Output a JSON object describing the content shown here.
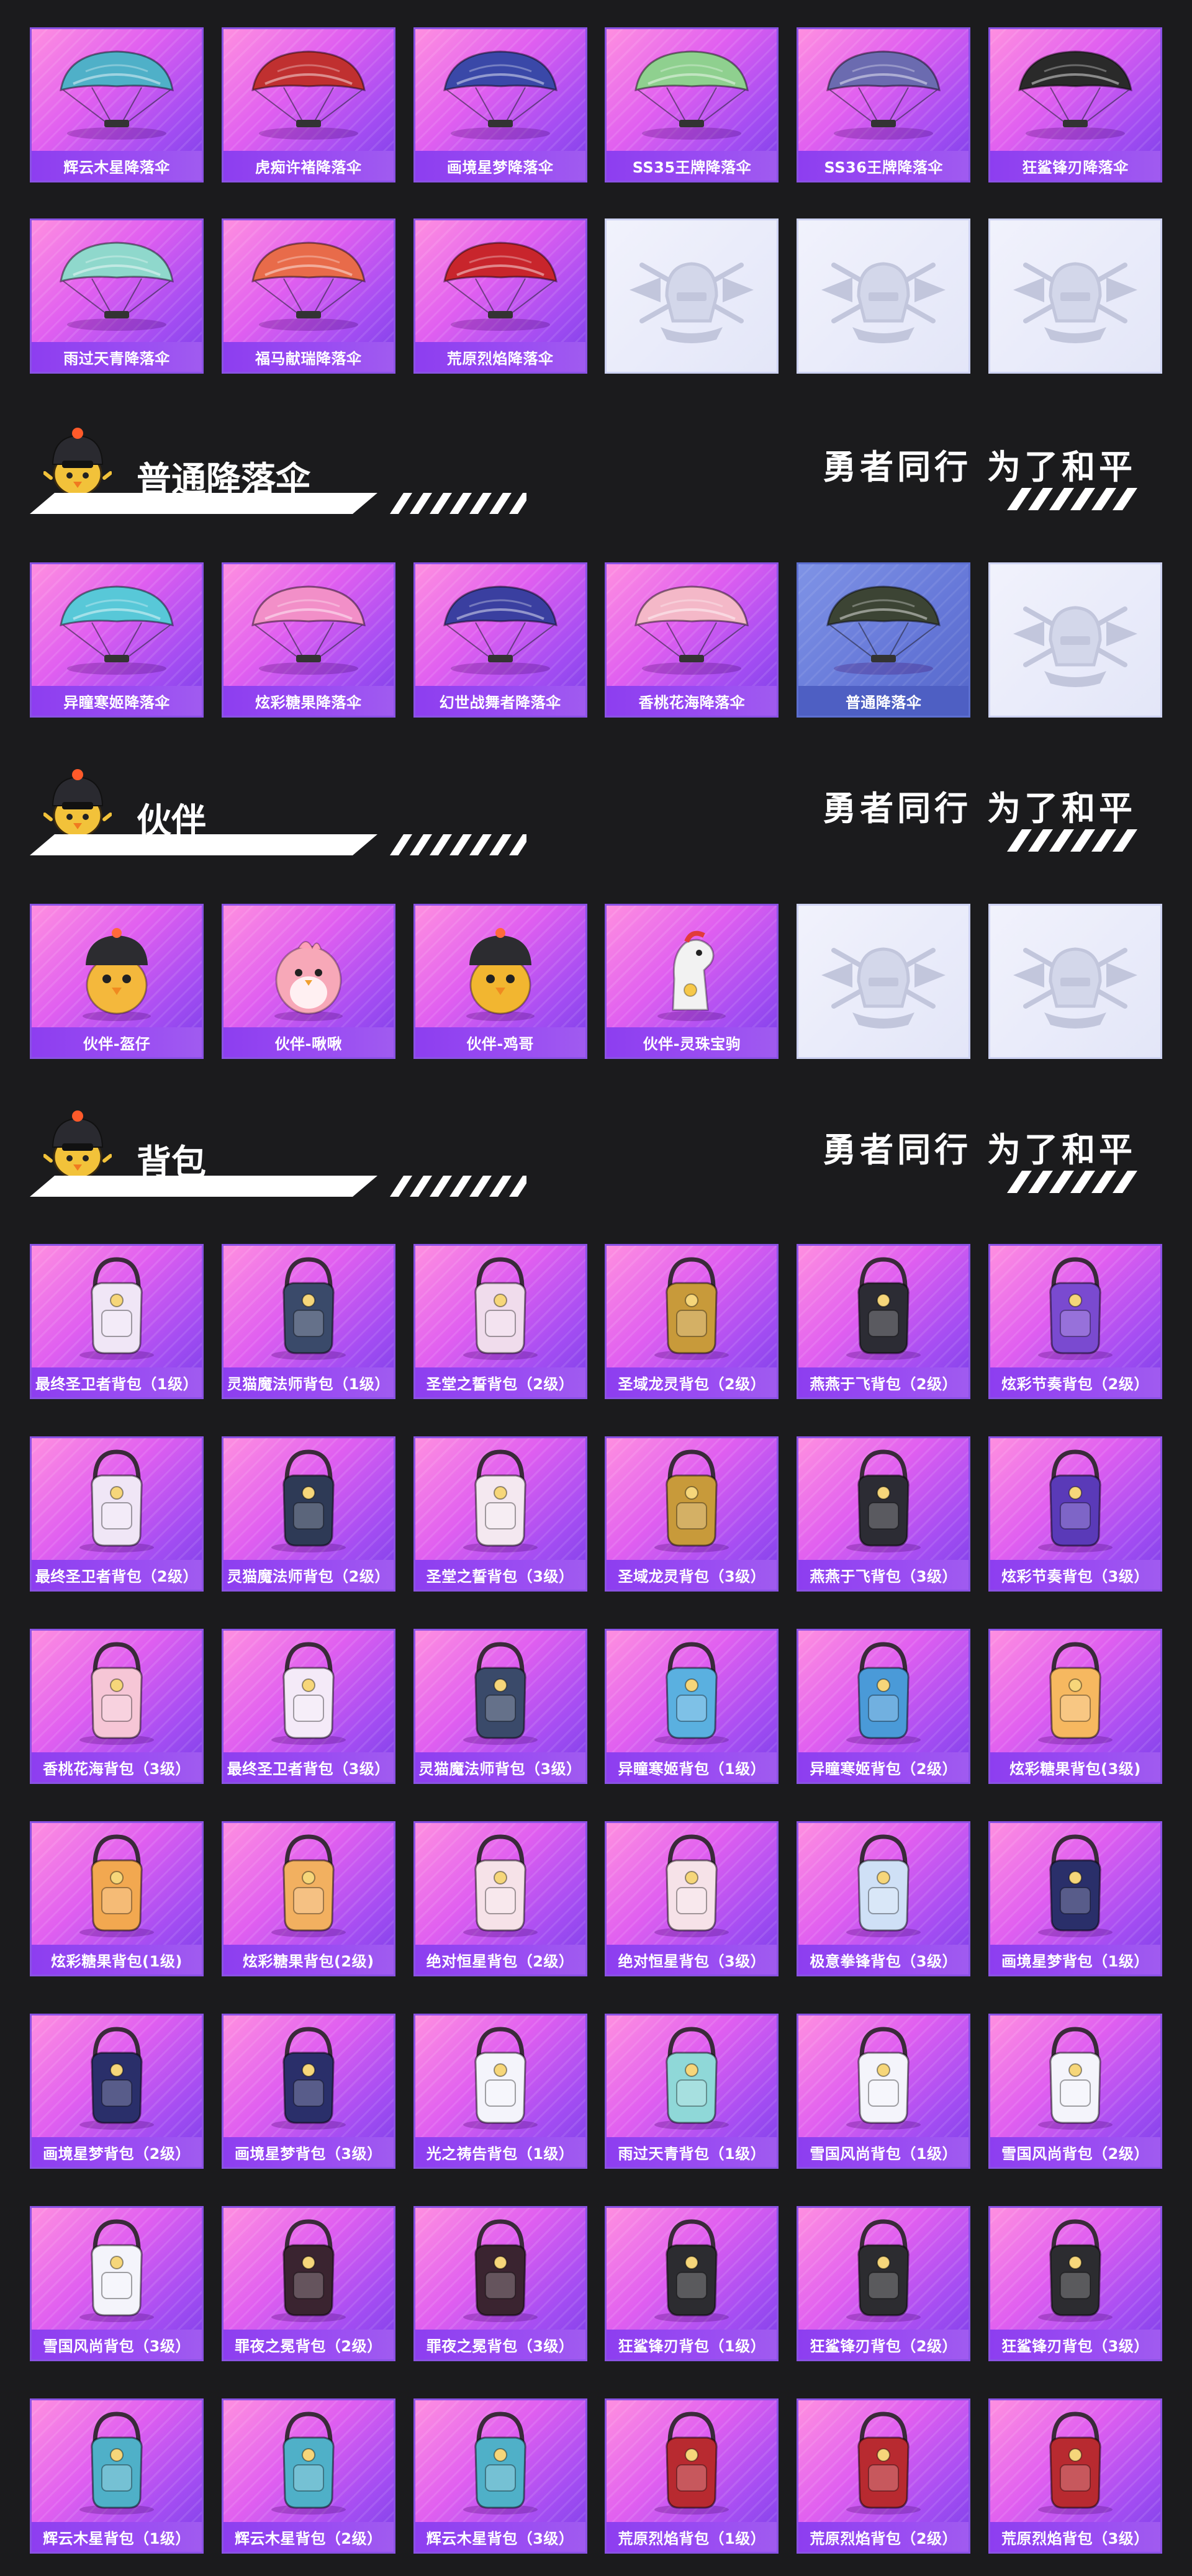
{
  "sections": [
    {
      "title": "",
      "slogan": "",
      "items": [
        {
          "label": "辉云木星降落伞",
          "icon": "parachute-icon",
          "color": "#4fb0c8",
          "type": "normal"
        },
        {
          "label": "虎痴许褚降落伞",
          "icon": "parachute-icon",
          "color": "#c03030",
          "type": "normal"
        },
        {
          "label": "画境星梦降落伞",
          "icon": "parachute-icon",
          "color": "#3a48a8",
          "type": "normal"
        },
        {
          "label": "SS35王牌降落伞",
          "icon": "parachute-icon",
          "color": "#8fd08f",
          "type": "normal"
        },
        {
          "label": "SS36王牌降落伞",
          "icon": "parachute-icon",
          "color": "#6b6bb0",
          "type": "normal"
        },
        {
          "label": "狂鲨锋刃降落伞",
          "icon": "parachute-icon",
          "color": "#2a2a2a",
          "type": "normal"
        },
        {
          "label": "雨过天青降落伞",
          "icon": "parachute-icon",
          "color": "#8fd8cc",
          "type": "normal"
        },
        {
          "label": "福马献瑞降落伞",
          "icon": "parachute-icon",
          "color": "#e86b4a",
          "type": "normal"
        },
        {
          "label": "荒原烈焰降落伞",
          "icon": "parachute-icon",
          "color": "#c8252c",
          "type": "normal"
        },
        {
          "label": "",
          "icon": "pubg-emblem-icon",
          "color": "#c2c6dc",
          "type": "empty"
        },
        {
          "label": "",
          "icon": "pubg-emblem-icon",
          "color": "#c2c6dc",
          "type": "empty"
        },
        {
          "label": "",
          "icon": "pubg-emblem-icon",
          "color": "#c2c6dc",
          "type": "empty"
        }
      ]
    },
    {
      "title": "普通降落伞",
      "slogan": "勇者同行 为了和平",
      "items": [
        {
          "label": "异瞳寒姬降落伞",
          "icon": "parachute-icon",
          "color": "#58c8d8",
          "type": "normal"
        },
        {
          "label": "炫彩糖果降落伞",
          "icon": "parachute-icon",
          "color": "#f28fc8",
          "type": "normal"
        },
        {
          "label": "幻世战舞者降落伞",
          "icon": "parachute-icon",
          "color": "#3a3fa0",
          "type": "normal"
        },
        {
          "label": "香桃花海降落伞",
          "icon": "parachute-icon",
          "color": "#f4b8c8",
          "type": "normal"
        },
        {
          "label": "普通降落伞",
          "icon": "parachute-icon",
          "color": "#3c4434",
          "type": "plain"
        },
        {
          "label": "",
          "icon": "pubg-emblem-icon",
          "color": "#c2c6dc",
          "type": "empty"
        }
      ]
    },
    {
      "title": "伙伴",
      "slogan": "勇者同行 为了和平",
      "items": [
        {
          "label": "伙伴-盔仔",
          "icon": "chick-companion-icon",
          "color": "#f4b83c",
          "type": "normal"
        },
        {
          "label": "伙伴-啾啾",
          "icon": "bird-companion-icon",
          "color": "#f7a8b8",
          "type": "normal"
        },
        {
          "label": "伙伴-鸡哥",
          "icon": "chick-companion-icon",
          "color": "#f2b630",
          "type": "normal"
        },
        {
          "label": "伙伴-灵珠宝驹",
          "icon": "horse-companion-icon",
          "color": "#f2f2f2",
          "type": "normal"
        },
        {
          "label": "",
          "icon": "pubg-emblem-icon",
          "color": "#c2c6dc",
          "type": "empty"
        },
        {
          "label": "",
          "icon": "pubg-emblem-icon",
          "color": "#c2c6dc",
          "type": "empty"
        }
      ]
    },
    {
      "title": "背包",
      "slogan": "勇者同行 为了和平",
      "items": [
        {
          "label": "最终圣卫者背包（1级）",
          "icon": "backpack-icon",
          "color": "#f0e6f6",
          "type": "normal"
        },
        {
          "label": "灵猫魔法师背包（1级）",
          "icon": "backpack-icon",
          "color": "#3a4a6a",
          "type": "normal"
        },
        {
          "label": "圣堂之誓背包（2级）",
          "icon": "backpack-icon",
          "color": "#f0dcec",
          "type": "normal"
        },
        {
          "label": "圣域龙灵背包（2级）",
          "icon": "backpack-icon",
          "color": "#c89a3a",
          "type": "normal"
        },
        {
          "label": "燕燕于飞背包（2级）",
          "icon": "backpack-icon",
          "color": "#2c2c34",
          "type": "normal"
        },
        {
          "label": "炫彩节奏背包（2级）",
          "icon": "backpack-icon",
          "color": "#7a4ad0",
          "type": "normal"
        },
        {
          "label": "最终圣卫者背包（2级）",
          "icon": "backpack-icon",
          "color": "#f0e6f6",
          "type": "normal"
        },
        {
          "label": "灵猫魔法师背包（2级）",
          "icon": "backpack-icon",
          "color": "#2e3a56",
          "type": "normal"
        },
        {
          "label": "圣堂之誓背包（3级）",
          "icon": "backpack-icon",
          "color": "#f4e8f0",
          "type": "normal"
        },
        {
          "label": "圣域龙灵背包（3级）",
          "icon": "backpack-icon",
          "color": "#c89a3a",
          "type": "normal"
        },
        {
          "label": "燕燕于飞背包（3级）",
          "icon": "backpack-icon",
          "color": "#2c2c34",
          "type": "normal"
        },
        {
          "label": "炫彩节奏背包（3级）",
          "icon": "backpack-icon",
          "color": "#5a3ab8",
          "type": "normal"
        },
        {
          "label": "香桃花海背包（3级）",
          "icon": "backpack-icon",
          "color": "#f6c6d6",
          "type": "normal"
        },
        {
          "label": "最终圣卫者背包（3级）",
          "icon": "backpack-icon",
          "color": "#f4eaf8",
          "type": "normal"
        },
        {
          "label": "灵猫魔法师背包（3级）",
          "icon": "backpack-icon",
          "color": "#3a4a6a",
          "type": "normal"
        },
        {
          "label": "异瞳寒姬背包（1级）",
          "icon": "backpack-icon",
          "color": "#5ab0e0",
          "type": "normal"
        },
        {
          "label": "异瞳寒姬背包（2级）",
          "icon": "backpack-icon",
          "color": "#4a9ad8",
          "type": "normal"
        },
        {
          "label": "炫彩糖果背包(3级)",
          "icon": "backpack-icon",
          "color": "#f6b860",
          "type": "normal"
        },
        {
          "label": "炫彩糖果背包(1级)",
          "icon": "backpack-icon",
          "color": "#f2a850",
          "type": "normal"
        },
        {
          "label": "炫彩糖果背包(2级)",
          "icon": "backpack-icon",
          "color": "#f2b060",
          "type": "normal"
        },
        {
          "label": "绝对恒星背包（2级）",
          "icon": "backpack-icon",
          "color": "#f6e2e8",
          "type": "normal"
        },
        {
          "label": "绝对恒星背包（3级）",
          "icon": "backpack-icon",
          "color": "#f6e2e8",
          "type": "normal"
        },
        {
          "label": "极意拳锋背包（3级）",
          "icon": "backpack-icon",
          "color": "#cfe0f6",
          "type": "normal"
        },
        {
          "label": "画境星梦背包（1级）",
          "icon": "backpack-icon",
          "color": "#2a2f6a",
          "type": "normal"
        },
        {
          "label": "画境星梦背包（2级）",
          "icon": "backpack-icon",
          "color": "#2a2f6a",
          "type": "normal"
        },
        {
          "label": "画境星梦背包（3级）",
          "icon": "backpack-icon",
          "color": "#2a2f6a",
          "type": "normal"
        },
        {
          "label": "光之祷告背包（1级）",
          "icon": "backpack-icon",
          "color": "#f4f4fb",
          "type": "normal"
        },
        {
          "label": "雨过天青背包（1级）",
          "icon": "backpack-icon",
          "color": "#8fd8d8",
          "type": "normal"
        },
        {
          "label": "雪国风尚背包（1级）",
          "icon": "backpack-icon",
          "color": "#f4f4fb",
          "type": "normal"
        },
        {
          "label": "雪国风尚背包（2级）",
          "icon": "backpack-icon",
          "color": "#f4f4fb",
          "type": "normal"
        },
        {
          "label": "雪国风尚背包（3级）",
          "icon": "backpack-icon",
          "color": "#f4f4fb",
          "type": "normal"
        },
        {
          "label": "罪夜之冕背包（2级）",
          "icon": "backpack-icon",
          "color": "#3a2430",
          "type": "normal"
        },
        {
          "label": "罪夜之冕背包（3级）",
          "icon": "backpack-icon",
          "color": "#3a2430",
          "type": "normal"
        },
        {
          "label": "狂鲨锋刃背包（1级）",
          "icon": "backpack-icon",
          "color": "#2c2c30",
          "type": "normal"
        },
        {
          "label": "狂鲨锋刃背包（2级）",
          "icon": "backpack-icon",
          "color": "#2c2c30",
          "type": "normal"
        },
        {
          "label": "狂鲨锋刃背包（3级）",
          "icon": "backpack-icon",
          "color": "#2c2c30",
          "type": "normal"
        },
        {
          "label": "辉云木星背包（1级）",
          "icon": "backpack-icon",
          "color": "#4fb0c8",
          "type": "normal"
        },
        {
          "label": "辉云木星背包（2级）",
          "icon": "backpack-icon",
          "color": "#4fb0c8",
          "type": "normal"
        },
        {
          "label": "辉云木星背包（3级）",
          "icon": "backpack-icon",
          "color": "#4fb0c8",
          "type": "normal"
        },
        {
          "label": "荒原烈焰背包（1级）",
          "icon": "backpack-icon",
          "color": "#b82a30",
          "type": "normal"
        },
        {
          "label": "荒原烈焰背包（2级）",
          "icon": "backpack-icon",
          "color": "#b82a30",
          "type": "normal"
        },
        {
          "label": "荒原烈焰背包（3级）",
          "icon": "backpack-icon",
          "color": "#b82a30",
          "type": "normal"
        }
      ]
    }
  ]
}
